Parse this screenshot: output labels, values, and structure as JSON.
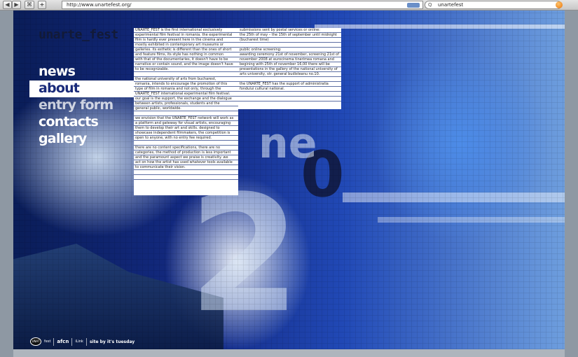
{
  "browser": {
    "url": "http://www.unartefest.org/",
    "search_query": "unartefest",
    "back_icon": "◀",
    "forward_icon": "▶",
    "bookmarks_icon": "⌘",
    "add_icon": "+",
    "reload_icon": "C",
    "search_icon": "Q"
  },
  "site": {
    "logo": "unarte_fest",
    "nav": [
      "news",
      "about",
      "entry form",
      "contacts",
      "gallery"
    ],
    "about_lines": [
      "UNARTE_FEST is the first international exclusively",
      "experimental film festival in romania. the experimental",
      "film is hardly ever present here in the cinema and",
      "mostly exhibited in contemporary art museums or",
      "galleries. its esthetic is different than the ones of short",
      "and feature films, its style has nothing in common",
      "with that of the documentaries, it doesn't have to be",
      "narrative or contain sound, and the image doesn't have",
      "to be recognizable.",
      "",
      "the national university of arts from bucharest,",
      "romania, intends to encourage the promotion of this",
      "type of film in romania and not only, through the",
      "UNARTE_FEST international experimental film festival.",
      "our goal is the support, the exchange and the dialogue",
      "between artists, professionals, students and the",
      "general public, worldwide.",
      "",
      "we envision that the UNARTE_FEST network will work as",
      "a platform and gateway for visual artists, encouraging",
      "them to develop their art and skills. designed to",
      "showcase independent filmmakers, the competition is",
      "open to anyone, with no entry fee required.",
      "",
      "there are no content specifications, there are no",
      "categories, the method of production is less important",
      "and the paramount aspect we praise is creativity. we",
      "act on how the artist has used whatever tools available",
      "to communicate their vision.",
      "",
      ""
    ],
    "info_lines": [
      "submissions sent by postal services or online:",
      "the 25th of may – the 15th of september until midnight",
      "(bucharest time)",
      "",
      "public online screening:",
      "awarding ceremony 21st of november, screening 21st of",
      "november 2008 at eurocinema tinerimea romana and",
      "begining with 25th of november 16,00 there will be",
      "presentations in the gallery of the national university of",
      "arts university, str. general budisteanu no.10.",
      "",
      "the UNARTE_FEST has the support of administratia",
      "fondului cultural national.",
      "",
      ""
    ],
    "footer": {
      "logo1": "UNAT",
      "logo1_suffix": "fest",
      "logo2": "afcn",
      "logo3": "iLink",
      "credit": "site by it's tuesday"
    }
  },
  "colors": {
    "accent": "#1a2b7a",
    "table_rule": "#5d6fa3",
    "background_blue": "#142b86"
  }
}
